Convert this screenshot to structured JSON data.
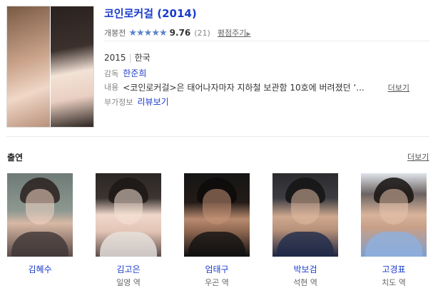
{
  "movie": {
    "title": "코인로커걸",
    "year": "(2014)",
    "status_label": "개봉전",
    "stars": "★★★★★",
    "score": "9.76",
    "rating_count": "(21)",
    "rate_link": "평점주기",
    "release_year": "2015",
    "country": "한국",
    "director_label": "감독",
    "director": "한준희",
    "plot_label": "내용",
    "plot": "<코인로커걸>은 태어나자마자 지하철 보관함 10호에 버려졌던 ‘...",
    "plot_more": "더보기",
    "extra_label": "부가정보",
    "extra_link": "리뷰보기"
  },
  "cast": {
    "title": "출연",
    "more": "더보기",
    "members": [
      {
        "name": "김혜수",
        "role": ""
      },
      {
        "name": "김고은",
        "role": "일영 역"
      },
      {
        "name": "엄태구",
        "role": "우곤 역"
      },
      {
        "name": "박보검",
        "role": "석현 역"
      },
      {
        "name": "고경표",
        "role": "치도 역"
      }
    ]
  },
  "colors": {
    "link": "#1a3ccb",
    "star": "#5a83c9"
  }
}
